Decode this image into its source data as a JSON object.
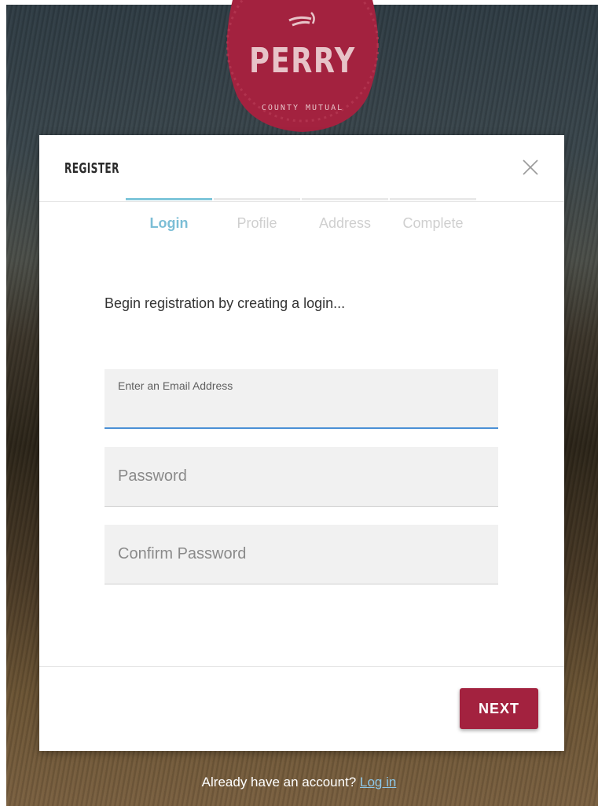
{
  "brand": {
    "name": "PERRY",
    "subtitle": "COUNTY MUTUAL",
    "color": "#a3223f",
    "icon": "wheat-icon"
  },
  "modal": {
    "title": "REGISTER",
    "close_icon": "close-icon",
    "steps": [
      {
        "label": "Login",
        "active": true
      },
      {
        "label": "Profile",
        "active": false
      },
      {
        "label": "Address",
        "active": false
      },
      {
        "label": "Complete",
        "active": false
      }
    ],
    "intro": "Begin registration by creating a login...",
    "fields": {
      "email": {
        "label": "Enter an Email Address",
        "value": ""
      },
      "password": {
        "placeholder": "Password",
        "value": ""
      },
      "confirm": {
        "placeholder": "Confirm Password",
        "value": ""
      }
    },
    "next_label": "NEXT"
  },
  "footer": {
    "prompt": "Already have an account?",
    "link": "Log in"
  },
  "colors": {
    "accent": "#7fc6da",
    "focus": "#4a90d6",
    "button": "#a3223f"
  }
}
